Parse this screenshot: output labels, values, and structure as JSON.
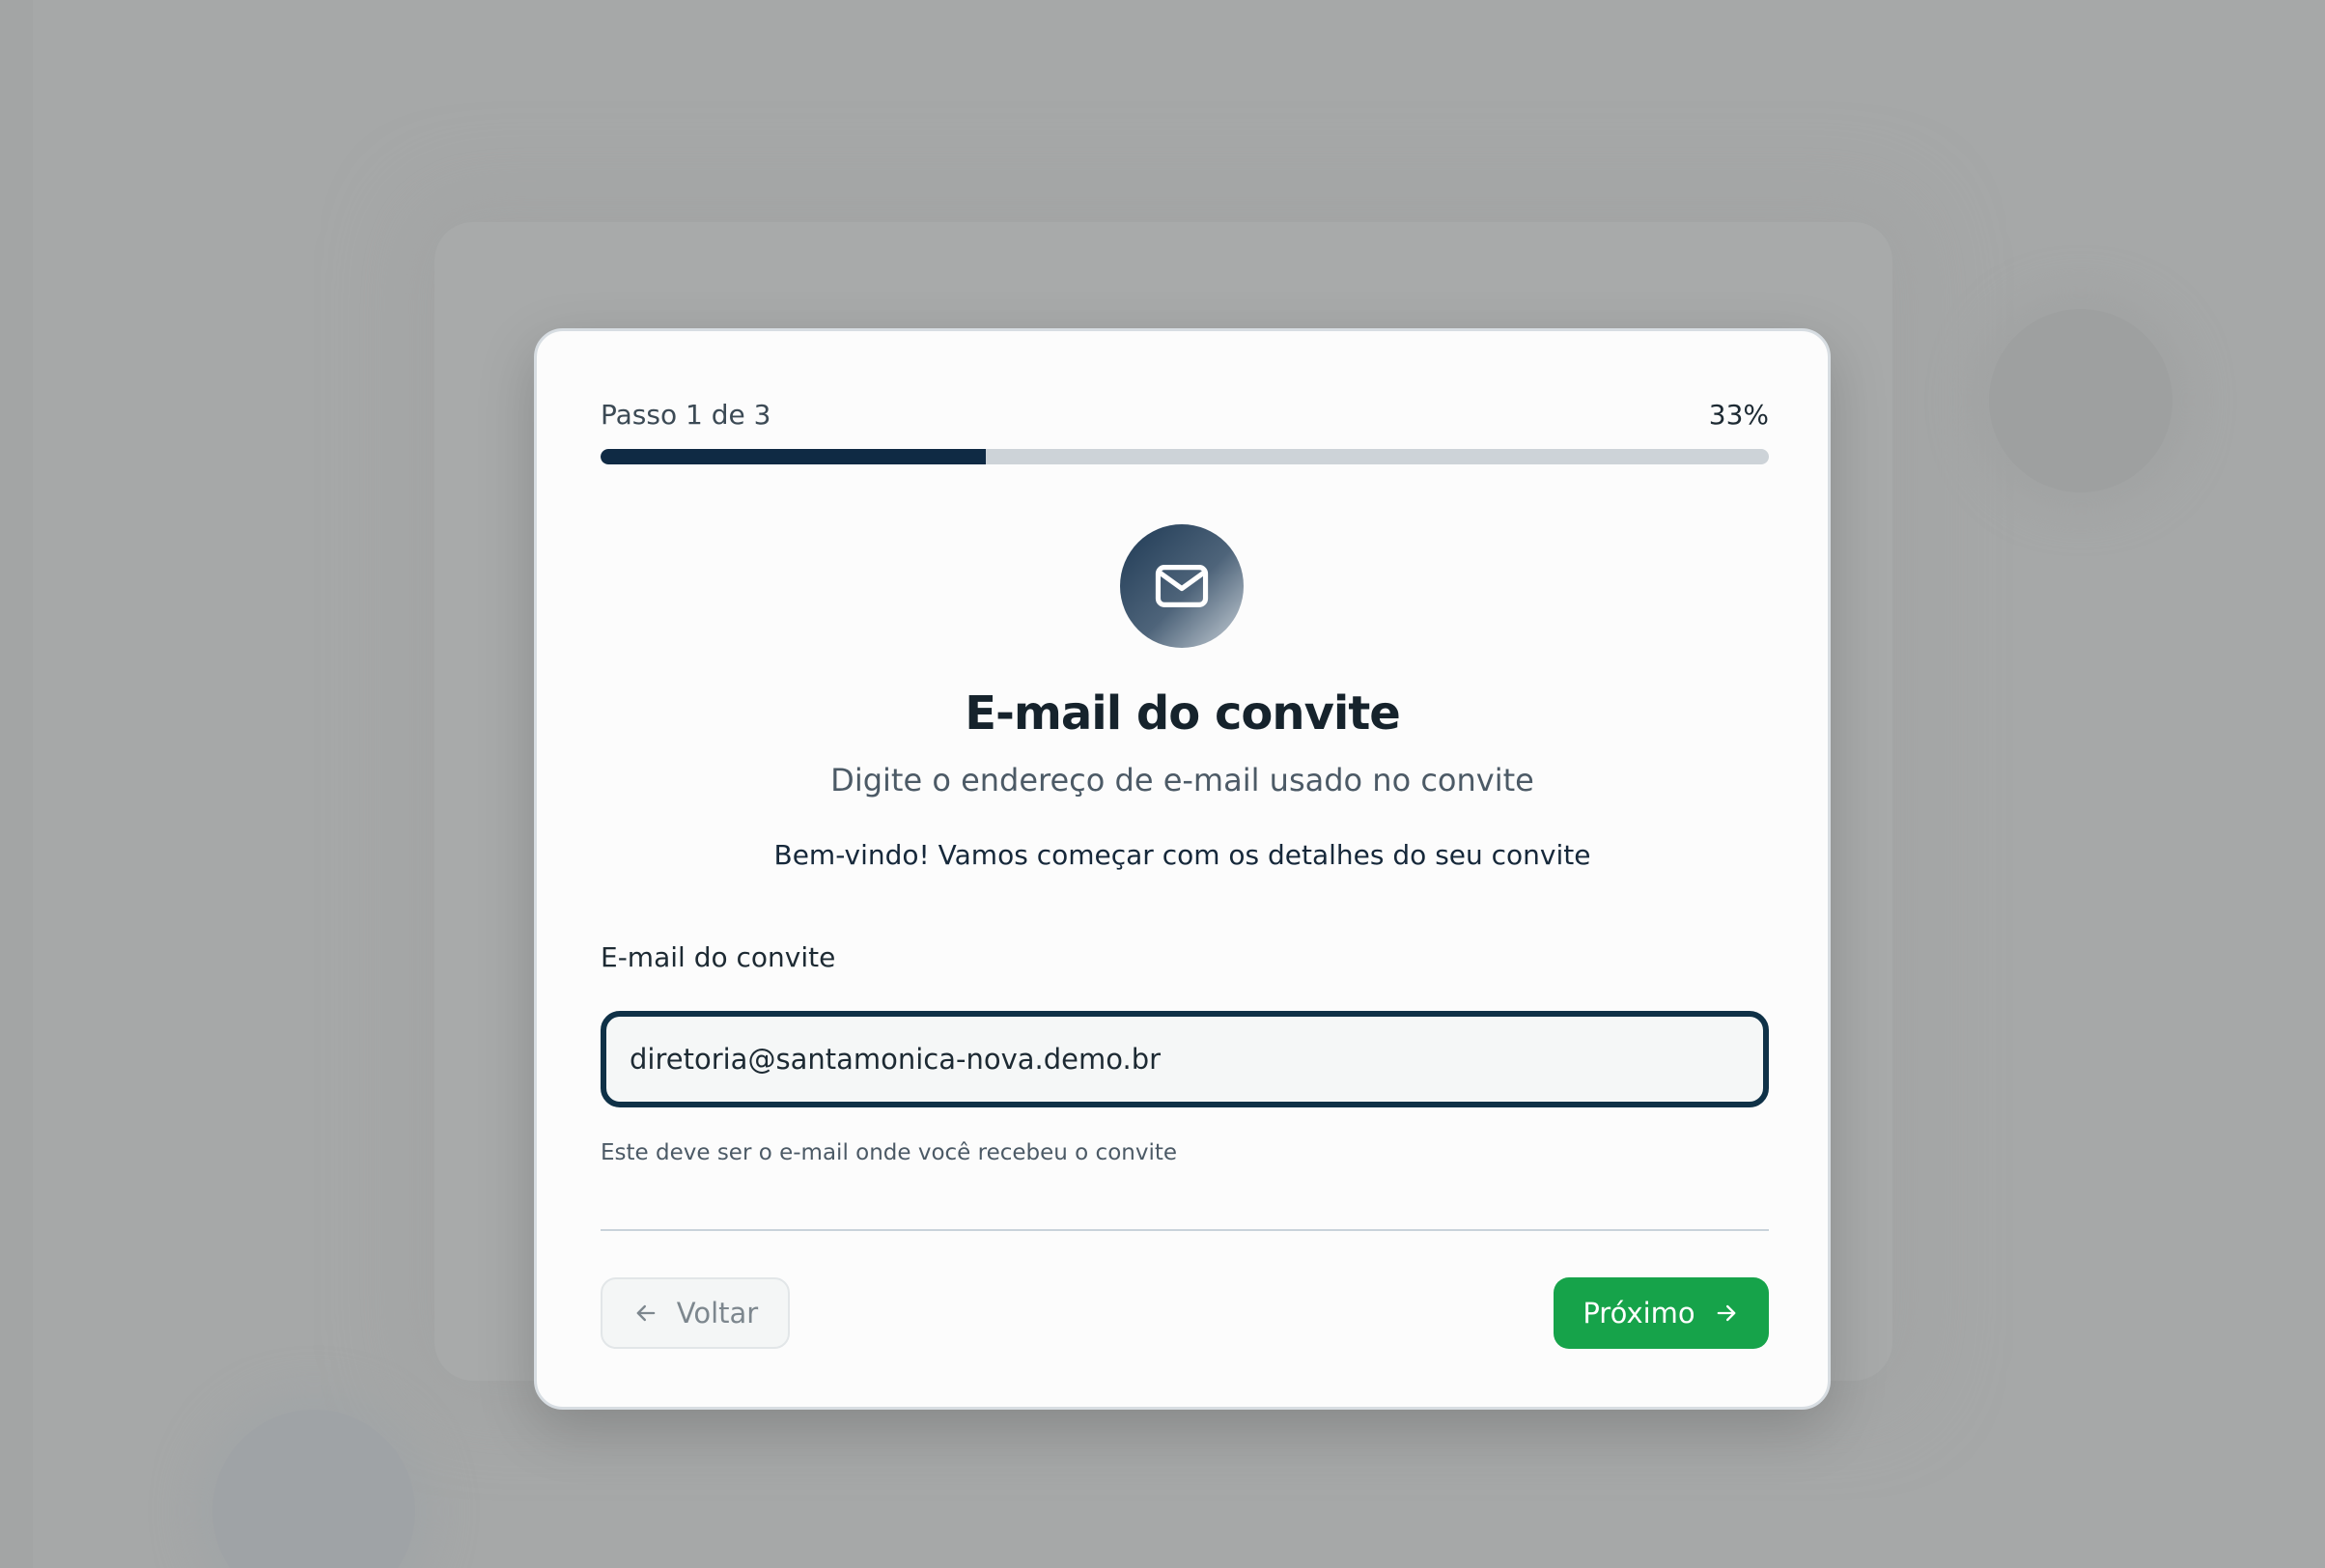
{
  "progress": {
    "step_label": "Passo 1 de 3",
    "percent_label": "33%",
    "percent": 33
  },
  "header": {
    "icon": "mail-icon",
    "title": "E-mail do convite",
    "subtitle": "Digite o endereço de e-mail usado no convite",
    "welcome": "Bem-vindo! Vamos começar com os detalhes do seu convite"
  },
  "form": {
    "email_label": "E-mail do convite",
    "email_value": "diretoria@santamonica-nova.demo.br",
    "hint": "Este deve ser o e-mail onde você recebeu o convite"
  },
  "footer": {
    "back_label": "Voltar",
    "back_icon": "arrow-left-icon",
    "next_label": "Próximo",
    "next_icon": "arrow-right-icon"
  },
  "colors": {
    "accent": "#0f2a44",
    "primary_button": "#16a34a",
    "overlay": "#a6a8a8"
  }
}
